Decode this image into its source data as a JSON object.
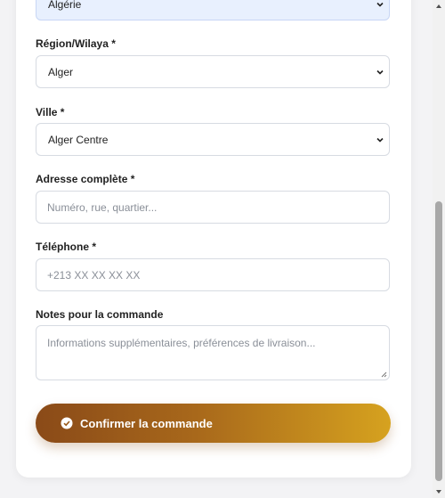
{
  "form": {
    "country": {
      "value": "Algérie"
    },
    "region": {
      "label": "Région/Wilaya *",
      "value": "Alger"
    },
    "city": {
      "label": "Ville *",
      "value": "Alger Centre"
    },
    "address": {
      "label": "Adresse complète *",
      "placeholder": "Numéro, rue, quartier..."
    },
    "phone": {
      "label": "Téléphone *",
      "placeholder": "+213 XX XX XX XX"
    },
    "notes": {
      "label": "Notes pour la commande",
      "placeholder": "Informations supplémentaires, préférences de livraison..."
    },
    "submit_label": "Confirmer la commande"
  },
  "colors": {
    "button_gradient_start": "#8a4a18",
    "button_gradient_end": "#d6a21f",
    "country_select_bg": "#e8f0fe"
  },
  "icons": {
    "select_chevron": "chevron-down-icon",
    "submit": "check-circle-icon",
    "resize": "resize-grip-icon"
  }
}
